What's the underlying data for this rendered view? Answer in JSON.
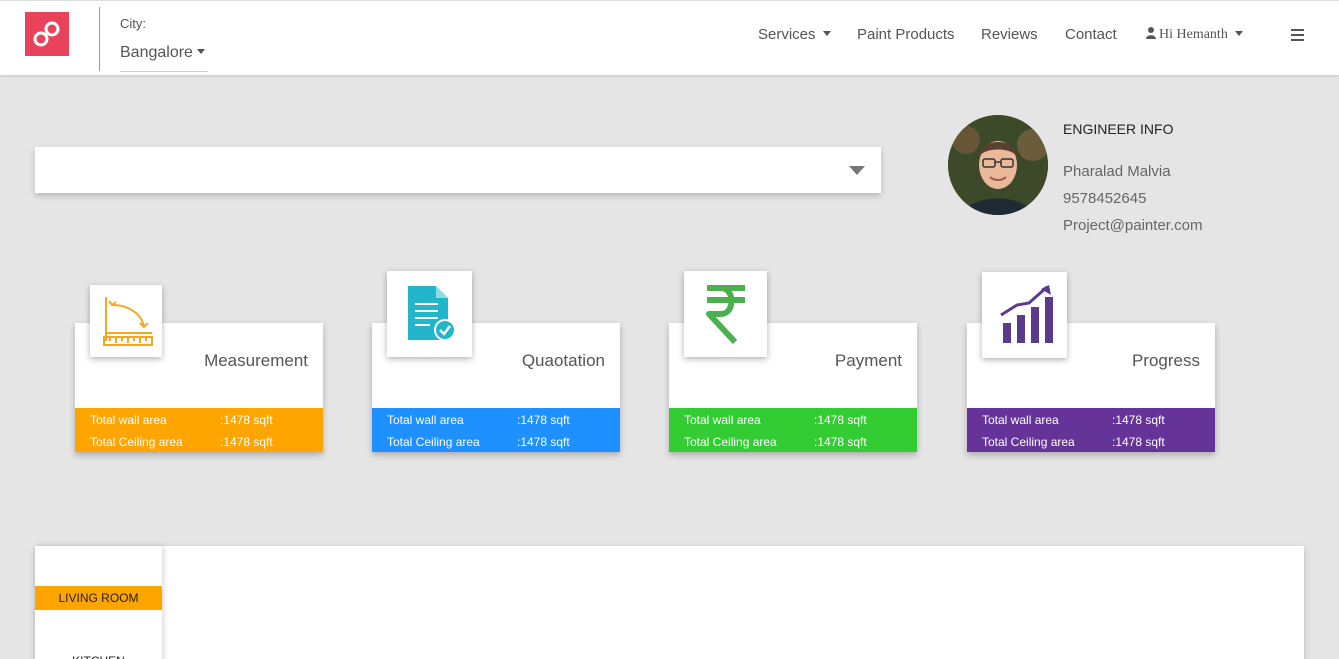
{
  "header": {
    "city_label": "City:",
    "city_value": "Bangalore",
    "nav": {
      "services": "Services",
      "paint_products": "Paint Products",
      "reviews": "Reviews",
      "contact": "Contact",
      "user": "Hi Hemanth"
    }
  },
  "engineer": {
    "title": "ENGINEER INFO",
    "name": "Pharalad Malvia",
    "phone": "9578452645",
    "email": "Project@painter.com"
  },
  "cards": [
    {
      "title": "Measurement",
      "color": "#ffa500",
      "icon": "measurement-icon",
      "rows": [
        {
          "label": "Total wall area",
          "value": ":1478 sqft"
        },
        {
          "label": "Total Ceiling area",
          "value": ":1478 sqft"
        }
      ]
    },
    {
      "title": "Quaotation",
      "color": "#1e90ff",
      "icon": "quotation-document-icon",
      "rows": [
        {
          "label": "Total wall area",
          "value": ":1478 sqft"
        },
        {
          "label": "Total Ceiling area",
          "value": ":1478 sqft"
        }
      ]
    },
    {
      "title": "Payment",
      "color": "#33cc33",
      "icon": "rupee-icon",
      "rows": [
        {
          "label": "Total wall area",
          "value": ":1478 sqft"
        },
        {
          "label": "Total Ceiling area",
          "value": ":1478 sqft"
        }
      ]
    },
    {
      "title": "Progress",
      "color": "#663399",
      "icon": "progress-chart-icon",
      "rows": [
        {
          "label": "Total wall area",
          "value": ":1478 sqft"
        },
        {
          "label": "Total Ceiling area",
          "value": ":1478 sqft"
        }
      ]
    }
  ],
  "rooms": [
    {
      "label": "LIVING ROOM",
      "active": true
    },
    {
      "label": "KITCHEN",
      "active": false
    }
  ],
  "colors": {
    "brand": "#e8435a",
    "background": "#e5e5e5"
  }
}
